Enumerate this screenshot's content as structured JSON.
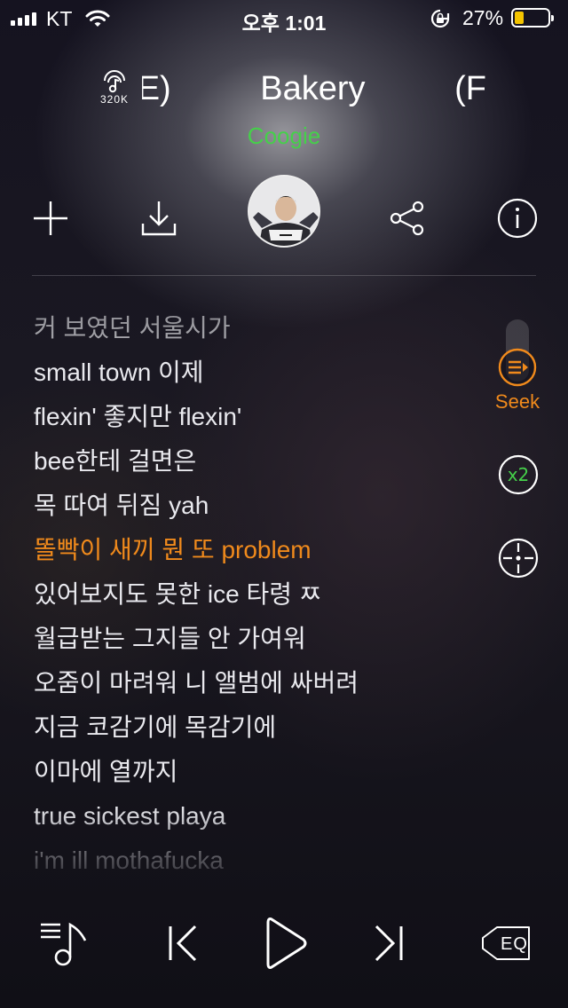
{
  "status_bar": {
    "carrier": "KT",
    "time": "오후 1:01",
    "battery_percent": "27%",
    "battery_level": 0.27,
    "battery_color": "#f4c400",
    "icons": [
      "signal-icon",
      "wifi-icon",
      "rotation-lock-icon",
      "battery-icon"
    ]
  },
  "header": {
    "quality_label": "320K",
    "title_visible": "BEE)        Bakery (F",
    "title_left_fragment": "BEE)",
    "title_right_fragment": "Bakery (F",
    "artist": "Coogie",
    "artist_color": "#45d04a"
  },
  "actions": {
    "icons": [
      "add-icon",
      "download-icon",
      "album-avatar",
      "share-icon",
      "info-icon"
    ]
  },
  "lyrics": {
    "active_color": "#f08a1c",
    "active_index": 5,
    "lines": [
      "커 보였던 서울시가",
      "small town 이제",
      "flexin' 좋지만 flexin'",
      "bee한테 걸면은",
      "목 따여 뒤짐 yah",
      "똘빡이 새끼 뭔 또 problem",
      "있어보지도 못한 ice 타령 ㅉ",
      "월급받는 그지들 안 가여워",
      "오줌이 마려워 니 앨범에 싸버려",
      "지금 코감기에 목감기에",
      "이마에 열까지",
      "true sickest playa",
      "i'm ill mothafucka"
    ]
  },
  "side_controls": {
    "seek_label": "Seek",
    "speed_label": "x2",
    "speed_color": "#45d04a",
    "seek_color": "#f08a1c"
  },
  "bottom_bar": {
    "eq_label": "EQ",
    "icons": [
      "playlist-icon",
      "previous-icon",
      "play-icon",
      "next-icon",
      "equalizer-icon"
    ]
  }
}
